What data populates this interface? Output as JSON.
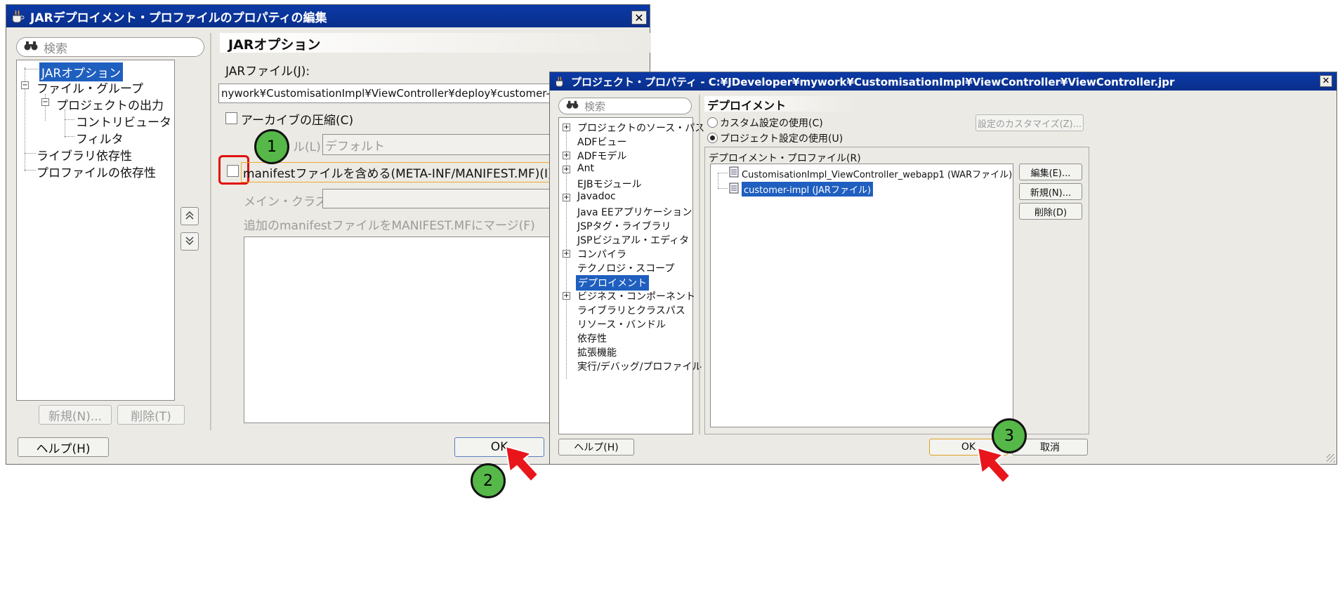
{
  "dialog1": {
    "title": "JARデプロイメント・プロファイルのプロパティの編集",
    "close": "✕",
    "search_placeholder": "検索",
    "tree": [
      "JARオプション",
      "ファイル・グループ",
      "プロジェクトの出力",
      "コントリビュータ",
      "フィルタ",
      "ライブラリ依存性",
      "プロファイルの依存性"
    ],
    "new_button": "新規(N)...",
    "delete_button": "削除(T)",
    "help_button": "ヘルプ(H)",
    "ok_button": "OK",
    "section_title": "JARオプション",
    "jar_file_label": "JARファイル(J):",
    "jar_file_value": "nywork¥CustomisationImpl¥ViewController¥deploy¥customer-impl.jar",
    "compress_label": "アーカイブの圧縮(C)",
    "level_label": "ル(L)",
    "level_value": "デフォルト",
    "manifest_label": "manifestファイルを含める(META-INF/MANIFEST.MF)(I)",
    "main_class_label": "メイン・クラス(M):",
    "merge_label": "追加のmanifestファイルをMANIFEST.MFにマージ(F)"
  },
  "dialog2": {
    "title": "プロジェクト・プロパティ - C:¥JDeveloper¥mywork¥CustomisationImpl¥ViewController¥ViewController.jpr",
    "close": "✕",
    "search_placeholder": "検索",
    "tree": [
      "プロジェクトのソース・パス",
      "ADFビュー",
      "ADFモデル",
      "Ant",
      "EJBモジュール",
      "Javadoc",
      "Java EEアプリケーション",
      "JSPタグ・ライブラリ",
      "JSPビジュアル・エディタ",
      "コンパイラ",
      "テクノロジ・スコープ",
      "デプロイメント",
      "ビジネス・コンポーネント",
      "ライブラリとクラスパス",
      "リソース・バンドル",
      "依存性",
      "拡張機能",
      "実行/デバッグ/プロファイル"
    ],
    "section_title": "デプロイメント",
    "custom_settings": "カスタム設定の使用(C)",
    "project_settings": "プロジェクト設定の使用(U)",
    "customize_button": "設定のカスタマイズ(Z)...",
    "profiles_label": "デプロイメント・プロファイル(R)",
    "profiles": [
      "CustomisationImpl_ViewController_webapp1 (WARファイル)",
      "customer-impl (JARファイル)"
    ],
    "edit_button": "編集(E)...",
    "new_button": "新規(N)...",
    "delete_button": "削除(D)",
    "help_button": "ヘルプ(H)",
    "ok_button": "OK",
    "cancel_button": "取消"
  },
  "callouts": [
    "1",
    "2",
    "3"
  ],
  "colors": {
    "highlight": "#1f5fbf",
    "callout": "#55b848",
    "arrow": "#e8151b",
    "marker": "#e01010"
  }
}
